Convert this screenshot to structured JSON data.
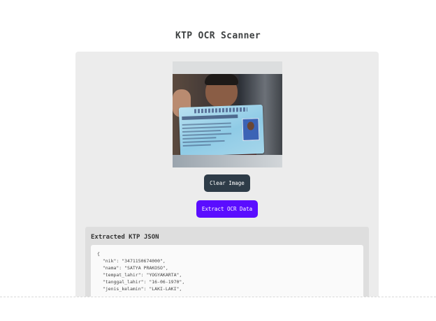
{
  "page": {
    "title": "KTP OCR Scanner"
  },
  "image_preview": {
    "alt": "KTP card photo"
  },
  "buttons": {
    "clear_label": "Clear Image",
    "extract_label": "Extract OCR Data"
  },
  "result": {
    "title": "Extracted KTP JSON",
    "json_text": "{\n  \"nik\": \"3471150674000\",\n  \"nama\": \"SATYA PRAKOSO\",\n  \"tempat_lahir\": \"YOGYAKARTA\",\n  \"tanggal_lahir\": \"16-06-1970\",\n  \"jenis_kelamin\": \"LAKI-LAKI\","
  },
  "colors": {
    "clear_button": "#2e3c48",
    "extract_button": "#5a0dff",
    "card_background": "#ececec"
  }
}
